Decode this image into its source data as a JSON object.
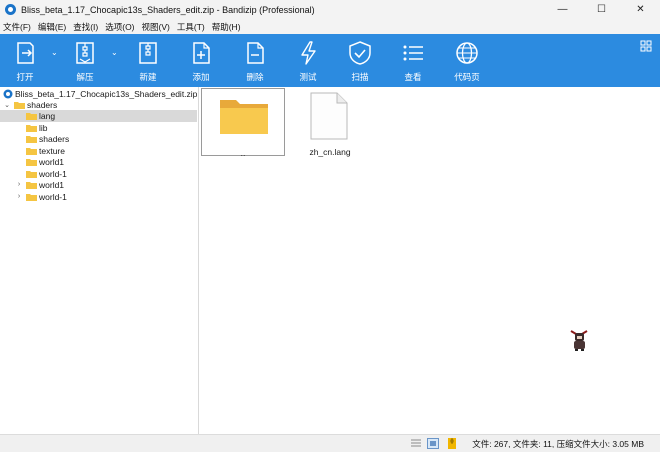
{
  "window": {
    "title": "Bliss_beta_1.17_Chocapic13s_Shaders_edit.zip - Bandizip (Professional)",
    "minimize": "—",
    "maximize": "☐",
    "close": "✕"
  },
  "menu": [
    "文件(F)",
    "编辑(E)",
    "查找(I)",
    "选项(O)",
    "视图(V)",
    "工具(T)",
    "帮助(H)"
  ],
  "toolbar": {
    "buttons": [
      {
        "label": "打开",
        "icon": "open-icon"
      },
      {
        "label": "解压",
        "icon": "extract-icon"
      },
      {
        "label": "新建",
        "icon": "new-archive-icon"
      },
      {
        "label": "添加",
        "icon": "add-file-icon"
      },
      {
        "label": "删除",
        "icon": "delete-file-icon"
      },
      {
        "label": "测试",
        "icon": "test-icon"
      },
      {
        "label": "扫描",
        "icon": "scan-shield-icon"
      },
      {
        "label": "查看",
        "icon": "view-list-icon"
      },
      {
        "label": "代码页",
        "icon": "globe-icon"
      }
    ],
    "accent": "#2c8be0"
  },
  "tree": {
    "root": "Bliss_beta_1.17_Chocapic13s_Shaders_edit.zip",
    "items": [
      {
        "label": "shaders",
        "expanded": true
      },
      {
        "label": "lang",
        "selected": true
      },
      {
        "label": "lib"
      },
      {
        "label": "shaders"
      },
      {
        "label": "texture"
      },
      {
        "label": "world1"
      },
      {
        "label": "world-1"
      },
      {
        "label": "world1",
        "collapsed": true
      },
      {
        "label": "world-1",
        "collapsed": true
      }
    ]
  },
  "files": [
    {
      "name": "..",
      "type": "folder"
    },
    {
      "name": "zh_cn.lang",
      "type": "file"
    }
  ],
  "status": {
    "text": "文件: 267, 文件夹: 11, 压缩文件大小: 3.05 MB"
  }
}
